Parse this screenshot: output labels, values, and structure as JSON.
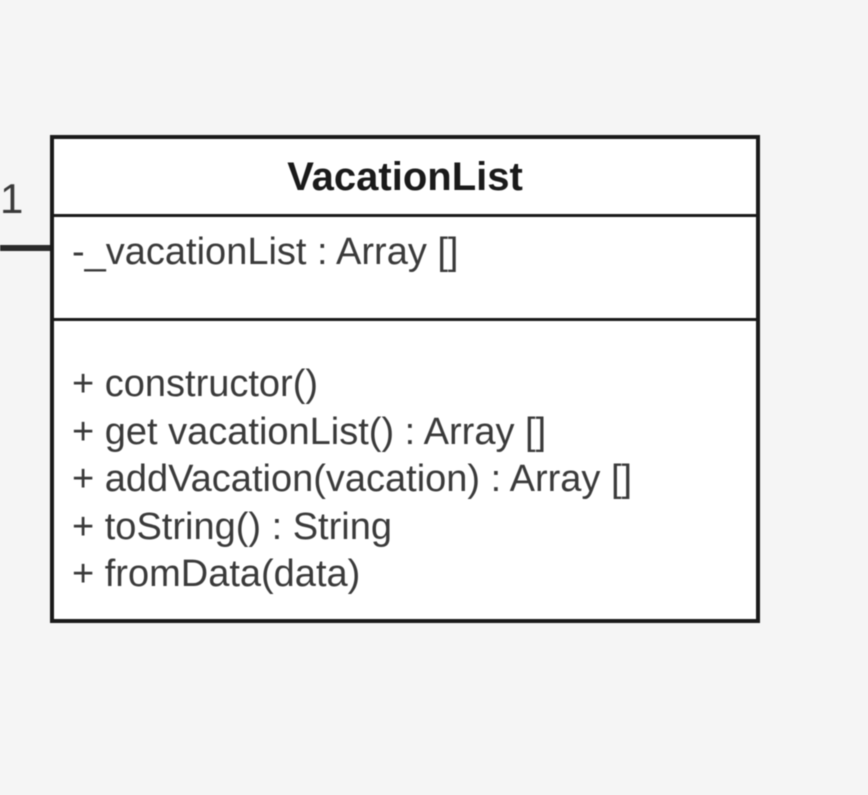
{
  "relation": {
    "multiplicity": "1"
  },
  "class": {
    "name": "VacationList",
    "attributes": [
      "-_vacationList : Array []"
    ],
    "operations": [
      "+ constructor()",
      "+ get vacationList() : Array []",
      "+ addVacation(vacation) : Array []",
      "+ toString() : String",
      "+ fromData(data)"
    ]
  }
}
